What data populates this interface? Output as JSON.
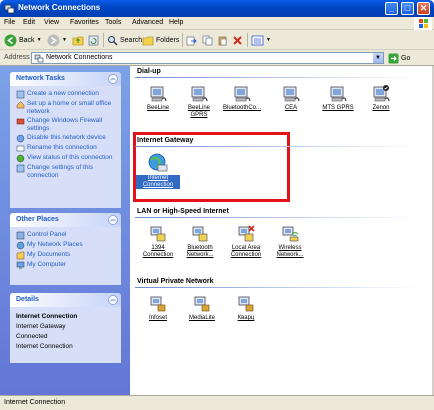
{
  "window": {
    "title": "Network Connections",
    "controls": {
      "minimize": "_",
      "maximize": "□",
      "close": "✕"
    }
  },
  "menu": [
    "File",
    "Edit",
    "View",
    "Favorites",
    "Tools",
    "Advanced",
    "Help"
  ],
  "toolbar": {
    "back": "Back",
    "search": "Search",
    "folders": "Folders"
  },
  "address": {
    "label": "Address",
    "value": "Network Connections",
    "go": "Go"
  },
  "tasks_panel": {
    "title": "Network Tasks",
    "items": [
      "Create a new connection",
      "Set up a home or small office network",
      "Change Windows Firewall settings",
      "Disable this network device",
      "Rename this connection",
      "View status of this connection",
      "Change settings of this connection"
    ]
  },
  "places_panel": {
    "title": "Other Places",
    "items": [
      "Control Panel",
      "My Network Places",
      "My Documents",
      "My Computer"
    ]
  },
  "details_panel": {
    "title": "Details",
    "name": "Internet Connection",
    "type": "Internet Gateway",
    "status": "Connected",
    "extra": "Internet Connection"
  },
  "groups": {
    "dialup": {
      "title": "Dial-up",
      "items": [
        "BeeLine",
        "BeeLine GPRS",
        "BluetoothCo...",
        "CEA",
        "MTS GPRS",
        "Zenon"
      ]
    },
    "gateway": {
      "title": "Internet Gateway",
      "items": [
        "Internet Connection"
      ]
    },
    "lan": {
      "title": "LAN or High-Speed Internet",
      "items": [
        "1394 Connection",
        "Bluetooth Network...",
        "Local Area Connection",
        "Wireless Network..."
      ]
    },
    "vpn": {
      "title": "Virtual Private Network",
      "items": [
        "Infoset",
        "MediaLite",
        "Кварц"
      ]
    }
  },
  "status": {
    "text": "Internet Connection"
  },
  "colors": {
    "accent": "#215dc6",
    "highlight": "#e2121a",
    "selection": "#316ac5"
  }
}
